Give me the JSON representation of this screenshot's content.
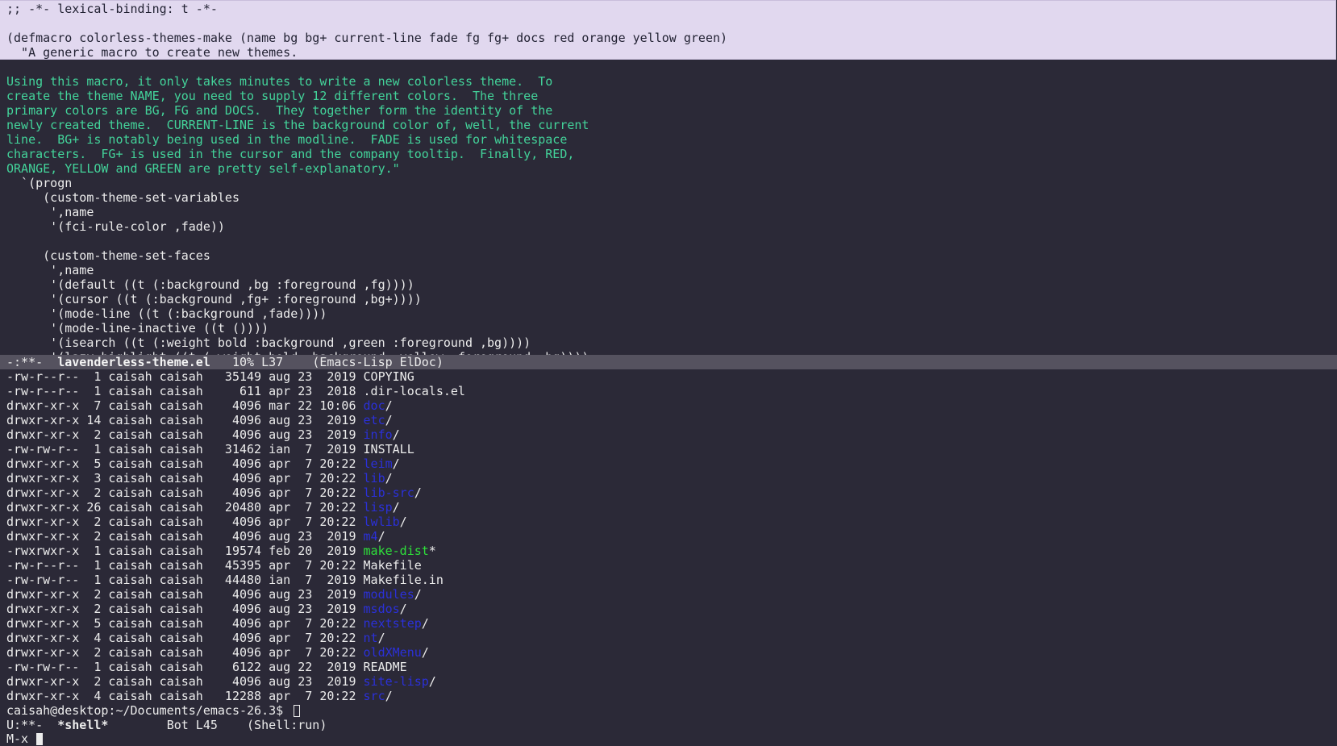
{
  "editor": {
    "header_lines": [
      ";; -*- lexical-binding: t -*-",
      "",
      "(defmacro colorless-themes-make (name bg bg+ current-line fade fg fg+ docs red orange yellow green)",
      "  \"A generic macro to create new themes."
    ],
    "doc_lines": [
      "",
      "Using this macro, it only takes minutes to write a new colorless theme.  To",
      "create the theme NAME, you need to supply 12 different colors.  The three",
      "primary colors are BG, FG and DOCS.  They together form the identity of the",
      "newly created theme.  CURRENT-LINE is the background color of, well, the current",
      "line.  BG+ is notably being used in the modline.  FADE is used for whitespace",
      "characters.  FG+ is used in the cursor and the company tooltip.  Finally, RED,",
      "ORANGE, YELLOW and GREEN are pretty self-explanatory.\""
    ],
    "code_lines": [
      "  `(progn",
      "     (custom-theme-set-variables",
      "      ',name",
      "      '(fci-rule-color ,fade))",
      "",
      "     (custom-theme-set-faces",
      "      ',name",
      "      '(default ((t (:background ,bg :foreground ,fg))))",
      "      '(cursor ((t (:background ,fg+ :foreground ,bg+))))",
      "      '(mode-line ((t (:background ,fade))))",
      "      '(mode-line-inactive ((t ())))",
      "      '(isearch ((t (:weight bold :background ,green :foreground ,bg))))",
      "      '(lazy-highlight ((t (:weight bold :background ,yellow :foreground ,bg))))"
    ]
  },
  "editor_modeline": {
    "status": "-:**-",
    "buffer_name": "lavenderless-theme.el",
    "position": "10% L37",
    "mode": "(Emacs-Lisp ElDoc)"
  },
  "shell": {
    "listing": [
      {
        "meta": "-rw-r--r--  1 caisah caisah   35149 aug 23  2019 ",
        "name": "COPYING",
        "kind": "file",
        "suffix": ""
      },
      {
        "meta": "-rw-r--r--  1 caisah caisah     611 apr 23  2018 ",
        "name": ".dir-locals.el",
        "kind": "file",
        "suffix": ""
      },
      {
        "meta": "drwxr-xr-x  7 caisah caisah    4096 mar 22 10:06 ",
        "name": "doc",
        "kind": "dir",
        "suffix": "/"
      },
      {
        "meta": "drwxr-xr-x 14 caisah caisah    4096 aug 23  2019 ",
        "name": "etc",
        "kind": "dir",
        "suffix": "/"
      },
      {
        "meta": "drwxr-xr-x  2 caisah caisah    4096 aug 23  2019 ",
        "name": "info",
        "kind": "dir",
        "suffix": "/"
      },
      {
        "meta": "-rw-rw-r--  1 caisah caisah   31462 ian  7  2019 ",
        "name": "INSTALL",
        "kind": "file",
        "suffix": ""
      },
      {
        "meta": "drwxr-xr-x  5 caisah caisah    4096 apr  7 20:22 ",
        "name": "leim",
        "kind": "dir",
        "suffix": "/"
      },
      {
        "meta": "drwxr-xr-x  3 caisah caisah    4096 apr  7 20:22 ",
        "name": "lib",
        "kind": "dir",
        "suffix": "/"
      },
      {
        "meta": "drwxr-xr-x  2 caisah caisah    4096 apr  7 20:22 ",
        "name": "lib-src",
        "kind": "dir",
        "suffix": "/"
      },
      {
        "meta": "drwxr-xr-x 26 caisah caisah   20480 apr  7 20:22 ",
        "name": "lisp",
        "kind": "dir",
        "suffix": "/"
      },
      {
        "meta": "drwxr-xr-x  2 caisah caisah    4096 apr  7 20:22 ",
        "name": "lwlib",
        "kind": "dir",
        "suffix": "/"
      },
      {
        "meta": "drwxr-xr-x  2 caisah caisah    4096 aug 23  2019 ",
        "name": "m4",
        "kind": "dir",
        "suffix": "/"
      },
      {
        "meta": "-rwxrwxr-x  1 caisah caisah   19574 feb 20  2019 ",
        "name": "make-dist",
        "kind": "exec",
        "suffix": "*"
      },
      {
        "meta": "-rw-r--r--  1 caisah caisah   45395 apr  7 20:22 ",
        "name": "Makefile",
        "kind": "file",
        "suffix": ""
      },
      {
        "meta": "-rw-rw-r--  1 caisah caisah   44480 ian  7  2019 ",
        "name": "Makefile.in",
        "kind": "file",
        "suffix": ""
      },
      {
        "meta": "drwxr-xr-x  2 caisah caisah    4096 aug 23  2019 ",
        "name": "modules",
        "kind": "dir",
        "suffix": "/"
      },
      {
        "meta": "drwxr-xr-x  2 caisah caisah    4096 aug 23  2019 ",
        "name": "msdos",
        "kind": "dir",
        "suffix": "/"
      },
      {
        "meta": "drwxr-xr-x  5 caisah caisah    4096 apr  7 20:22 ",
        "name": "nextstep",
        "kind": "dir",
        "suffix": "/"
      },
      {
        "meta": "drwxr-xr-x  4 caisah caisah    4096 apr  7 20:22 ",
        "name": "nt",
        "kind": "dir",
        "suffix": "/"
      },
      {
        "meta": "drwxr-xr-x  2 caisah caisah    4096 apr  7 20:22 ",
        "name": "oldXMenu",
        "kind": "dir",
        "suffix": "/"
      },
      {
        "meta": "-rw-rw-r--  1 caisah caisah    6122 aug 22  2019 ",
        "name": "README",
        "kind": "file",
        "suffix": ""
      },
      {
        "meta": "drwxr-xr-x  2 caisah caisah    4096 aug 23  2019 ",
        "name": "site-lisp",
        "kind": "dir",
        "suffix": "/"
      },
      {
        "meta": "drwxr-xr-x  4 caisah caisah   12288 apr  7 20:22 ",
        "name": "src",
        "kind": "dir",
        "suffix": "/"
      }
    ],
    "prompt": "caisah@desktop:~/Documents/emacs-26.3$ "
  },
  "shell_modeline": {
    "status": "U:**-",
    "buffer_name": "*shell*",
    "position": "Bot L45",
    "mode": "(Shell:run)"
  },
  "minibuffer": {
    "prompt": "M-x "
  },
  "colors": {
    "background": "#2b2937",
    "highlight": "#e1d8ef",
    "docstring": "#43d39a",
    "directory": "#2b30d8",
    "executable": "#2ee03a",
    "modeline_active": "#55525f"
  }
}
